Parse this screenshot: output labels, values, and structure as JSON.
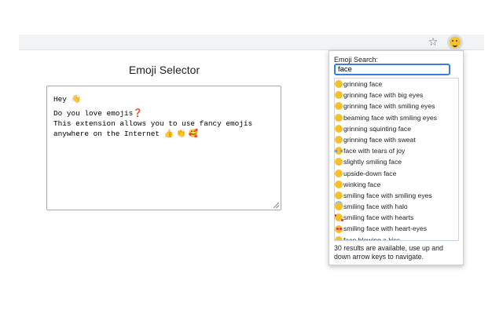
{
  "browser": {
    "star_glyph": "☆",
    "extension_icon": "emoji-face-icon"
  },
  "page": {
    "title": "Emoji Selector"
  },
  "editor": {
    "lines": [
      {
        "text": "Hey ",
        "emoji": "👋"
      },
      {
        "text": "Do you love emojis",
        "emoji": "❓"
      },
      {
        "text": "This extension allows you to use fancy emojis",
        "emoji": ""
      },
      {
        "text": "anywhere on the Internet ",
        "emoji": "👍 👏 🥰"
      }
    ]
  },
  "popup": {
    "label": "Emoji Search:",
    "search_value": "face",
    "results": [
      {
        "label": "grinning face",
        "icon": "grinning-face-icon"
      },
      {
        "label": "grinning face with big eyes",
        "icon": "grinning-face-big-eyes-icon"
      },
      {
        "label": "grinning face with smiling eyes",
        "icon": "grinning-face-smiling-eyes-icon"
      },
      {
        "label": "beaming face with smiling eyes",
        "icon": "beaming-face-icon"
      },
      {
        "label": "grinning squinting face",
        "icon": "grinning-squinting-face-icon"
      },
      {
        "label": "grinning face with sweat",
        "icon": "grinning-face-sweat-icon"
      },
      {
        "label": "face with tears of joy",
        "icon": "tears-of-joy-icon"
      },
      {
        "label": "slightly smiling face",
        "icon": "slightly-smiling-face-icon"
      },
      {
        "label": "upside-down face",
        "icon": "upside-down-face-icon"
      },
      {
        "label": "winking face",
        "icon": "winking-face-icon"
      },
      {
        "label": "smiling face with smiling eyes",
        "icon": "smiling-face-smiling-eyes-icon"
      },
      {
        "label": "smiling face with halo",
        "icon": "halo-face-icon"
      },
      {
        "label": "smiling face with hearts",
        "icon": "hearts-face-icon"
      },
      {
        "label": "smiling face with heart-eyes",
        "icon": "heart-eyes-face-icon"
      },
      {
        "label": "face blowing a kiss",
        "icon": "kiss-face-icon"
      }
    ],
    "status": "30 results are available, use up and down arrow keys to navigate."
  },
  "colors": {
    "accent": "#3b7ddd",
    "emoji_yellow": "#f6c02d"
  }
}
